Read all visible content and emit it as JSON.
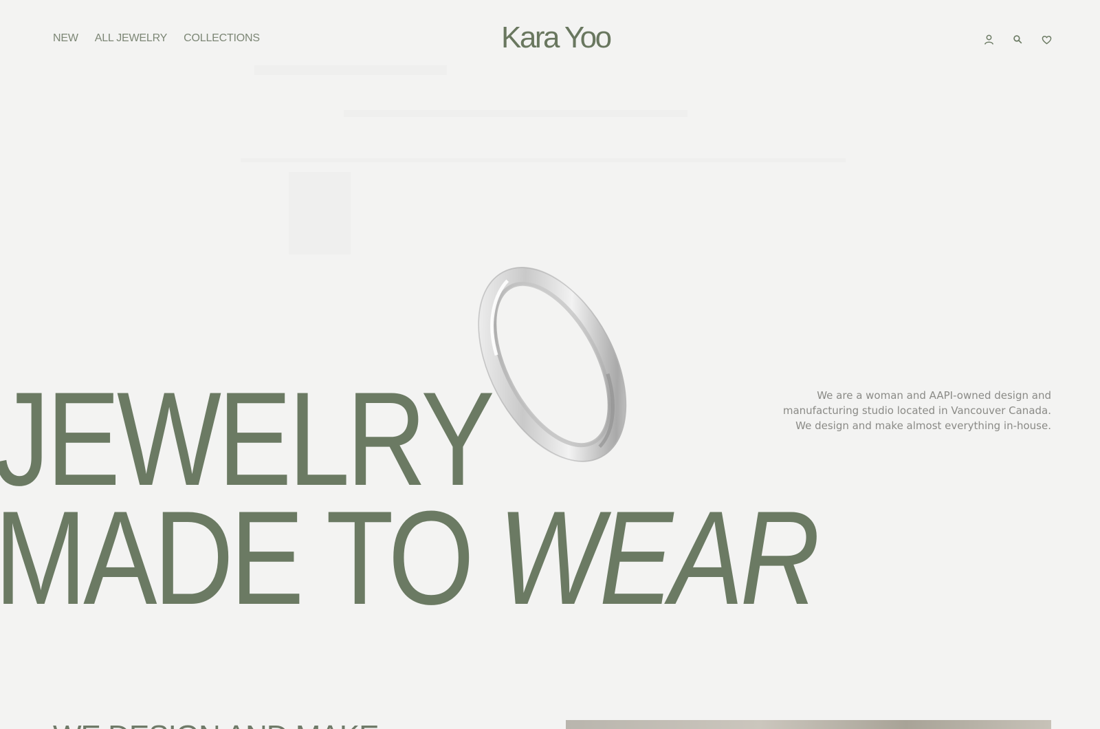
{
  "header": {
    "nav": [
      {
        "label": "NEW"
      },
      {
        "label": "ALL JEWELRY"
      },
      {
        "label": "COLLECTIONS"
      }
    ],
    "logo": "Kara Yoo",
    "icons": [
      "account-icon",
      "search-icon",
      "wishlist-heart-icon"
    ]
  },
  "hero": {
    "line1": "JEWELRY",
    "line2_regular": "MADE TO",
    "line2_italic": "WEAR",
    "intro_lines": [
      "We are a woman and AAPI-owned design and",
      "manufacturing studio located in Vancouver Canada.",
      "We design and make almost everything in-house."
    ],
    "image": "silver-ring-photo"
  },
  "next_section": {
    "heading": "WE DESIGN AND MAKE"
  },
  "colors": {
    "background": "#f3f3f2",
    "accent_green": "#6b7a63",
    "nav_text": "#7c8675",
    "body_text": "#8a8a86"
  }
}
